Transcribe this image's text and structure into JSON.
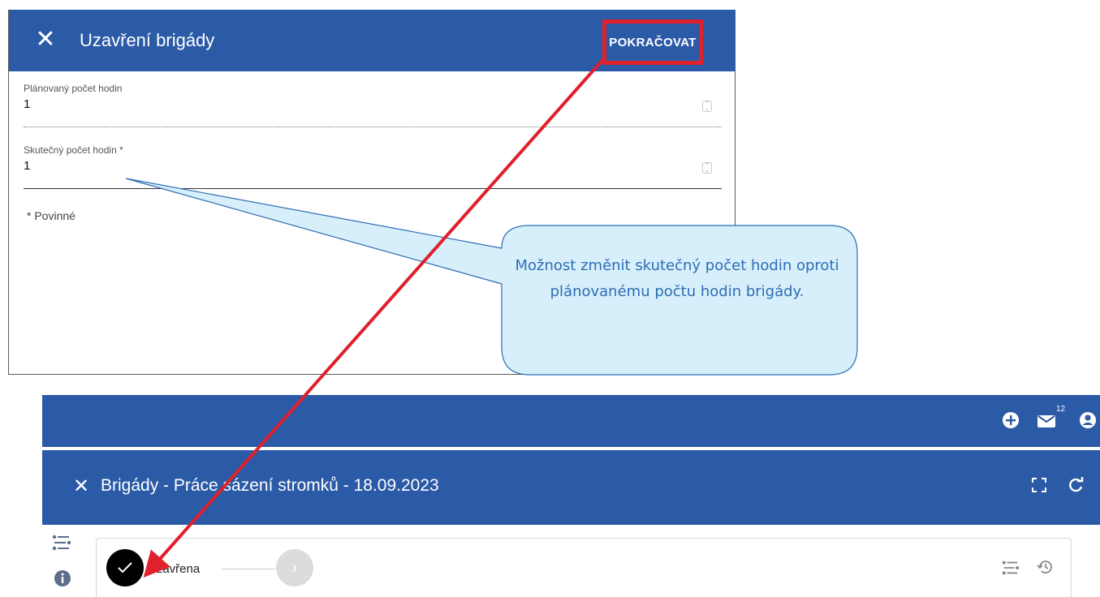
{
  "dialog": {
    "title": "Uzavření brigády",
    "close_icon": "close-icon",
    "continue_label": "POKRAČOVAT",
    "fields": [
      {
        "label": "Plánovaný počet hodin",
        "value": "1"
      },
      {
        "label": "Skutečný počet hodin *",
        "value": "1"
      }
    ],
    "required_note": "* Povinné"
  },
  "callout": {
    "text": "Možnost změnit skutečný počet hodin oproti plánovanému počtu hodin brigády."
  },
  "app": {
    "notifications_count": "12",
    "page_title": "Brigády - Práce sázení stromků - 18.09.2023",
    "status_step_label": "Uzavřena"
  },
  "colors": {
    "header_blue": "#2b5aa7",
    "highlight_red": "#e0202a",
    "callout_fill": "#d7effa",
    "callout_text": "#2e6db4"
  }
}
